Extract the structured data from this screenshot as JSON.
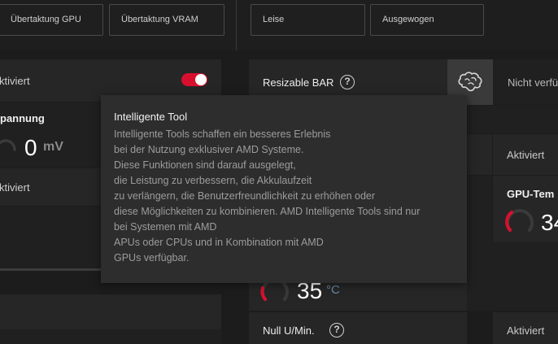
{
  "top_buttons": [
    {
      "label": "Übertaktung GPU"
    },
    {
      "label": "Übertaktung VRAM"
    },
    {
      "label": "Leise"
    },
    {
      "label": "Ausgewogen"
    }
  ],
  "left": {
    "toggle_status": "ktiviert",
    "toggle_on": true,
    "voltage_title": "pannung",
    "voltage_value": "0",
    "voltage_unit": "mV",
    "status2": "ktiviert"
  },
  "right": {
    "resizable_bar_label": "Resizable BAR",
    "resizable_bar_value": "Nicht verfü",
    "status_activated": "Aktiviert",
    "gpu_temp_title": "GPU-Tem",
    "gpu_temp_value": "34",
    "temp_value": "35",
    "temp_unit": "°C",
    "zero_rpm_label": "Null U/Min.",
    "zero_rpm_value": "Aktiviert"
  },
  "tooltip": {
    "title": "Intelligente Tool",
    "lines": [
      "Intelligente Tools schaffen ein besseres Erlebnis",
      "bei der Nutzung exklusiver AMD Systeme.",
      "Diese Funktionen sind darauf ausgelegt,",
      "die Leistung zu verbessern, die Akkulaufzeit",
      "zu verlängern, die Benutzerfreundlichkeit zu erhöhen oder",
      "diese Möglichkeiten zu kombinieren. AMD Intelligente Tools sind nur",
      "bei Systemen mit AMD",
      "APUs oder CPUs und in Kombination mit AMD",
      "GPUs verfügbar."
    ]
  },
  "colors": {
    "accent": "#d8102e",
    "background": "#1c1c1c",
    "panel": "#262626"
  },
  "icons": {
    "help": "question-circle-icon",
    "brain": "brain-icon",
    "gauge": "gauge-ring-icon"
  }
}
